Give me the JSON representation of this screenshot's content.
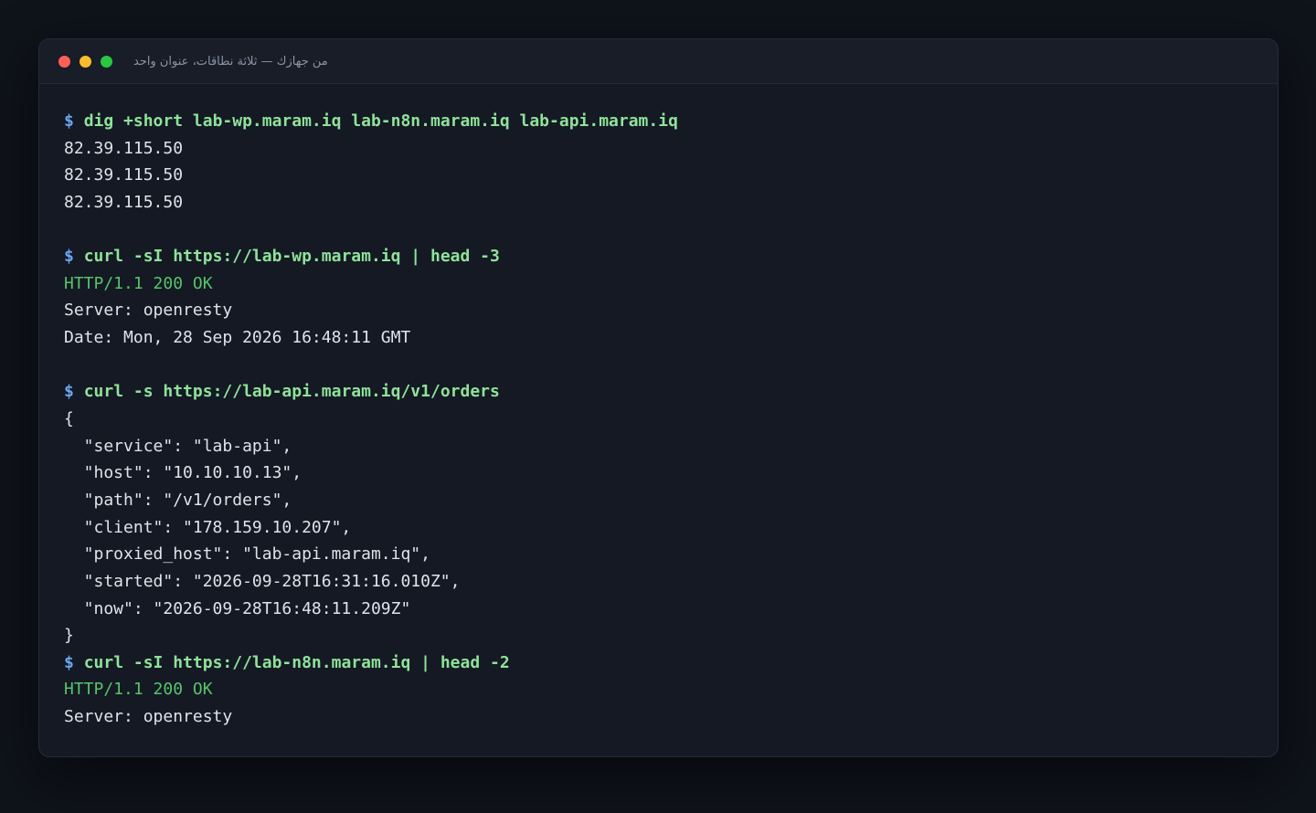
{
  "window": {
    "title": "من جهازك — ثلاثة نطاقات، عنوان واحد"
  },
  "prompt_symbol": "$",
  "terminal": {
    "lines": [
      {
        "type": "cmd",
        "text": "dig +short lab-wp.maram.iq lab-n8n.maram.iq lab-api.maram.iq"
      },
      {
        "type": "out",
        "text": "82.39.115.50"
      },
      {
        "type": "out",
        "text": "82.39.115.50"
      },
      {
        "type": "out",
        "text": "82.39.115.50"
      },
      {
        "type": "blank",
        "text": ""
      },
      {
        "type": "cmd",
        "text": "curl -sI https://lab-wp.maram.iq | head -3"
      },
      {
        "type": "ok",
        "text": "HTTP/1.1 200 OK"
      },
      {
        "type": "out",
        "text": "Server: openresty"
      },
      {
        "type": "out",
        "text": "Date: Mon, 28 Sep 2026 16:48:11 GMT"
      },
      {
        "type": "blank",
        "text": ""
      },
      {
        "type": "cmd",
        "text": "curl -s https://lab-api.maram.iq/v1/orders"
      },
      {
        "type": "out",
        "text": "{"
      },
      {
        "type": "out",
        "text": "  \"service\": \"lab-api\","
      },
      {
        "type": "out",
        "text": "  \"host\": \"10.10.10.13\","
      },
      {
        "type": "out",
        "text": "  \"path\": \"/v1/orders\","
      },
      {
        "type": "out",
        "text": "  \"client\": \"178.159.10.207\","
      },
      {
        "type": "out",
        "text": "  \"proxied_host\": \"lab-api.maram.iq\","
      },
      {
        "type": "out",
        "text": "  \"started\": \"2026-09-28T16:31:16.010Z\","
      },
      {
        "type": "out",
        "text": "  \"now\": \"2026-09-28T16:48:11.209Z\""
      },
      {
        "type": "out",
        "text": "}"
      },
      {
        "type": "cmd",
        "text": "curl -sI https://lab-n8n.maram.iq | head -2"
      },
      {
        "type": "ok",
        "text": "HTTP/1.1 200 OK"
      },
      {
        "type": "out",
        "text": "Server: openresty"
      }
    ]
  }
}
